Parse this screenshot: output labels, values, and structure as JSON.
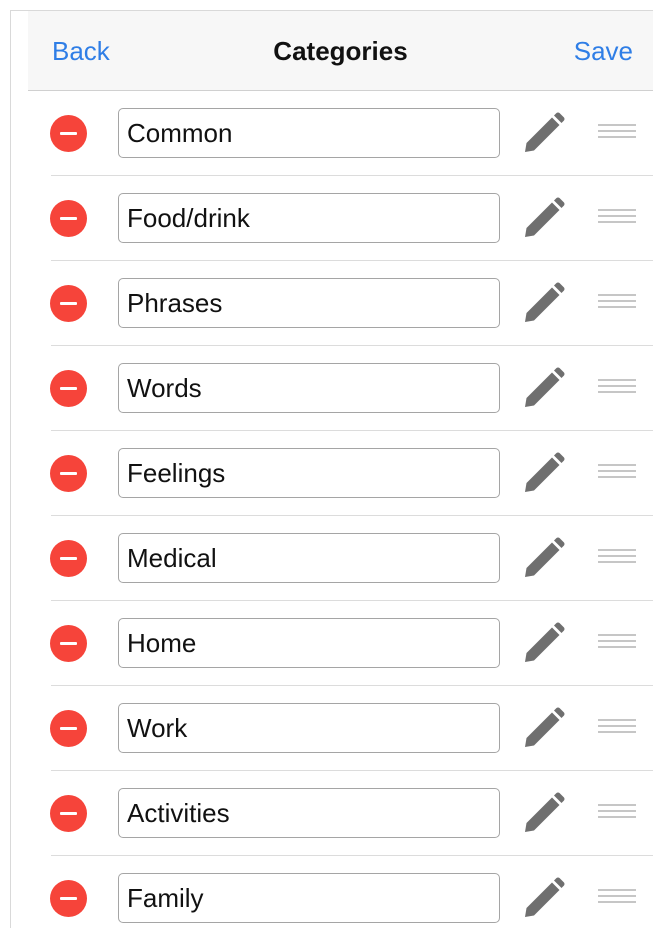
{
  "nav": {
    "back_label": "Back",
    "title": "Categories",
    "save_label": "Save"
  },
  "colors": {
    "accent": "#2f7ee6",
    "delete": "#f6443a",
    "icon_gray": "#6f6f6f",
    "handle_gray": "#c6c6c6"
  },
  "icons": {
    "delete": "minus-circle-icon",
    "edit": "pencil-icon",
    "reorder": "drag-handle-icon"
  },
  "categories": [
    {
      "value": "Common"
    },
    {
      "value": "Food/drink"
    },
    {
      "value": "Phrases"
    },
    {
      "value": "Words"
    },
    {
      "value": "Feelings"
    },
    {
      "value": "Medical"
    },
    {
      "value": "Home"
    },
    {
      "value": "Work"
    },
    {
      "value": "Activities"
    },
    {
      "value": "Family"
    }
  ]
}
